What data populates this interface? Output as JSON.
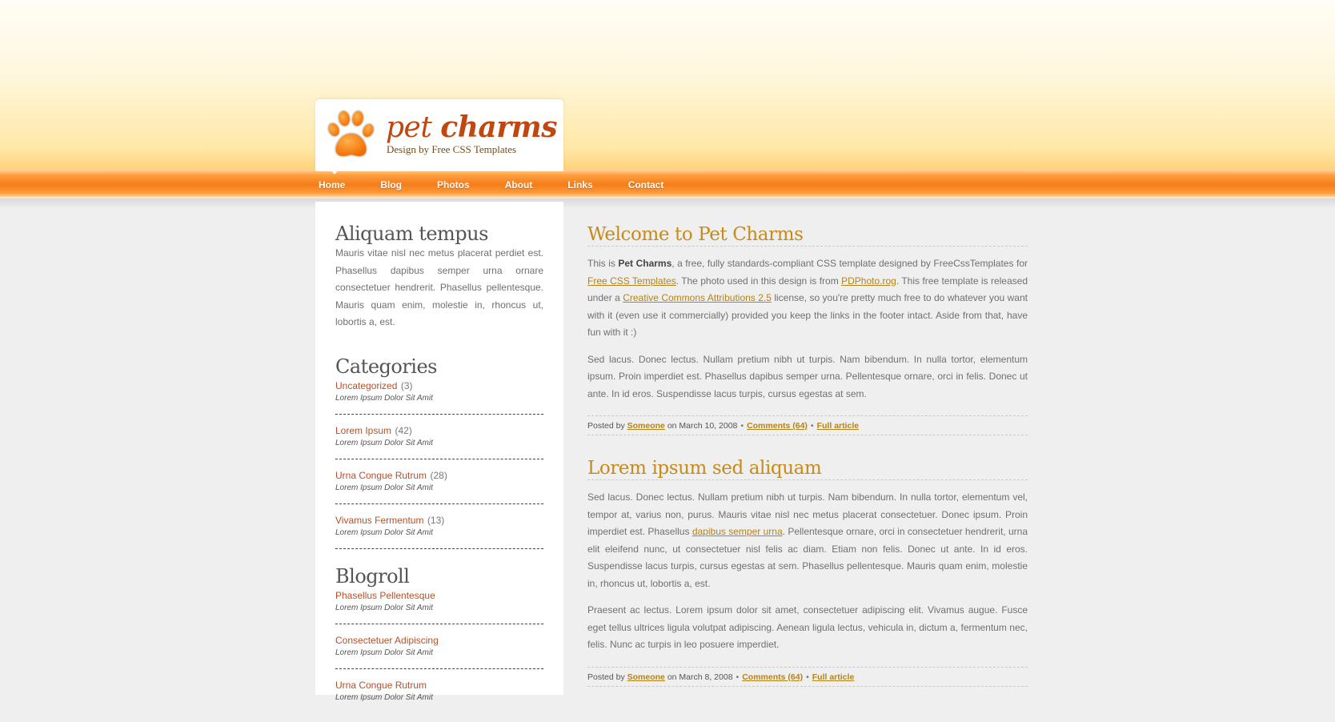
{
  "header": {
    "title_light": "pet",
    "title_bold": "charms",
    "tagline": "Design by Free CSS Templates"
  },
  "nav": {
    "items": [
      "Home",
      "Blog",
      "Photos",
      "About",
      "Links",
      "Contact"
    ]
  },
  "sidebar": {
    "about": {
      "heading": "Aliquam tempus",
      "text": "Mauris vitae nisl nec metus placerat perdiet est. Phasellus dapibus semper urna ornare consectetuer hendrerit. Phasellus pellentesque. Mauris quam enim, molestie in, rhoncus ut, lobortis a, est."
    },
    "categories": {
      "heading": "Categories",
      "items": [
        {
          "label": "Uncategorized",
          "count": "(3)",
          "desc": "Lorem Ipsum Dolor Sit Amit"
        },
        {
          "label": "Lorem Ipsum",
          "count": "(42)",
          "desc": "Lorem Ipsum Dolor Sit Amit"
        },
        {
          "label": "Urna Congue Rutrum",
          "count": "(28)",
          "desc": "Lorem Ipsum Dolor Sit Amit"
        },
        {
          "label": "Vivamus Fermentum",
          "count": "(13)",
          "desc": "Lorem Ipsum Dolor Sit Amit"
        }
      ]
    },
    "blogroll": {
      "heading": "Blogroll",
      "items": [
        {
          "label": "Phasellus Pellentesque",
          "desc": "Lorem Ipsum Dolor Sit Amit"
        },
        {
          "label": "Consectetuer Adipiscing",
          "desc": "Lorem Ipsum Dolor Sit Amit"
        },
        {
          "label": "Urna Congue Rutrum",
          "desc": "Lorem Ipsum Dolor Sit Amit"
        }
      ]
    }
  },
  "posts": [
    {
      "title": "Welcome to Pet Charms",
      "p1": {
        "t1": "This is ",
        "b1": "Pet Charms",
        "t2": ", a free, fully standards-compliant CSS template designed by FreeCssTemplates for ",
        "l1": "Free CSS Templates",
        "t3": ". The photo used in this design is from ",
        "l2": "PDPhoto.rog",
        "t4": ". This free template is released under a ",
        "l3": "Creative Commons Attributions 2.5",
        "t5": " license, so you're pretty much free to do whatever you want with it (even use it commercially) provided you keep the links in the footer intact. Aside from that, have fun with it :)"
      },
      "p2": "Sed lacus. Donec lectus. Nullam pretium nibh ut turpis. Nam bibendum. In nulla tortor, elementum ipsum. Proin imperdiet est. Phasellus dapibus semper urna. Pellentesque ornare, orci in felis. Donec ut ante. In id eros. Suspendisse lacus turpis, cursus egestas at sem.",
      "meta": {
        "posted_by": "Posted by",
        "author": "Someone",
        "date": "on March 10, 2008",
        "comments": "Comments (64)",
        "full": "Full article"
      }
    },
    {
      "title": "Lorem ipsum sed aliquam",
      "p1": {
        "t1": "Sed lacus. Donec lectus. Nullam pretium nibh ut turpis. Nam bibendum. In nulla tortor, elementum vel, tempor at, varius non, purus. Mauris vitae nisl nec metus placerat consectetuer. Donec ipsum. Proin imperdiet est. Phasellus ",
        "l1": "dapibus semper urna",
        "t2": ". Pellentesque ornare, orci in consectetuer hendrerit, urna elit eleifend nunc, ut consectetuer nisl felis ac diam. Etiam non felis. Donec ut ante. In id eros. Suspendisse lacus turpis, cursus egestas at sem. Phasellus pellentesque. Mauris quam enim, molestie in, rhoncus ut, lobortis a, est."
      },
      "p2": "Praesent ac lectus. Lorem ipsum dolor sit amet, consectetuer adipiscing elit. Vivamus augue. Fusce eget tellus ultrices ligula volutpat adipiscing. Aenean ligula lectus, vehicula in, dictum a, fermentum nec, felis. Nunc ac turpis in leo posuere imperdiet.",
      "meta": {
        "posted_by": "Posted by",
        "author": "Someone",
        "date": "on March 8, 2008",
        "comments": "Comments (64)",
        "full": "Full article"
      }
    }
  ]
}
